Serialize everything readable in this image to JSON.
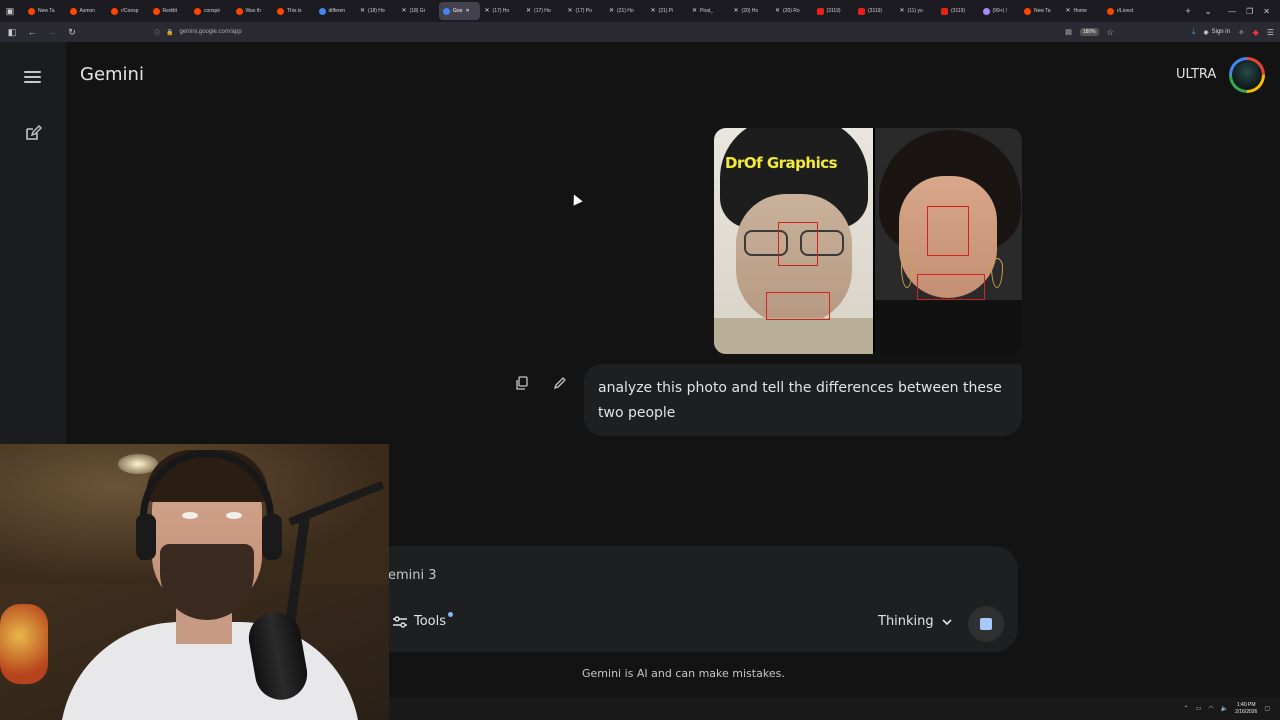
{
  "browser": {
    "tabs": [
      {
        "label": "New Ta",
        "icon": "reddit"
      },
      {
        "label": "Asmon",
        "icon": "reddit"
      },
      {
        "label": "r/Consp",
        "icon": "reddit"
      },
      {
        "label": "Reddit",
        "icon": "reddit"
      },
      {
        "label": "conspir",
        "icon": "reddit"
      },
      {
        "label": "Was th",
        "icon": "reddit"
      },
      {
        "label": "This is",
        "icon": "reddit"
      },
      {
        "label": "differen",
        "icon": "google"
      },
      {
        "label": "(18) Ho",
        "icon": "x"
      },
      {
        "label": "(18) Gr",
        "icon": "x"
      },
      {
        "label": "Goo",
        "icon": "google",
        "active": true
      },
      {
        "label": "(17) Ho",
        "icon": "x"
      },
      {
        "label": "(17) Ho",
        "icon": "x"
      },
      {
        "label": "(17) Po",
        "icon": "x"
      },
      {
        "label": "(21) Ho",
        "icon": "x"
      },
      {
        "label": "(21) Pi",
        "icon": "x"
      },
      {
        "label": "Pirat_",
        "icon": "x"
      },
      {
        "label": "(20) Ho",
        "icon": "x"
      },
      {
        "label": "(20) Ro",
        "icon": "x"
      },
      {
        "label": "(3119)",
        "icon": "yt"
      },
      {
        "label": "(3119)",
        "icon": "yt"
      },
      {
        "label": "(11) yo",
        "icon": "x"
      },
      {
        "label": "(3119)",
        "icon": "yt"
      },
      {
        "label": "(99+) /",
        "icon": "other"
      },
      {
        "label": "New Ta",
        "icon": "reddit"
      },
      {
        "label": "Home",
        "icon": "x"
      },
      {
        "label": "r/Livest",
        "icon": "reddit"
      }
    ],
    "new_tab": "+",
    "tab_list": "⌄",
    "url": "gemini.google.com/app",
    "zoom": "180%",
    "signin": "Sign in"
  },
  "app": {
    "brand": "Gemini",
    "plan": "ULTRA"
  },
  "conversation": {
    "image_watermark": "DrOf Graphics",
    "prompt": "analyze this photo and tell the differences between these two people"
  },
  "composer": {
    "placeholder": "emini 3",
    "tools_label": "Tools",
    "mode_label": "Thinking",
    "disclaimer": "Gemini is AI and can make mistakes."
  },
  "taskbar": {
    "time": "1:40 PM",
    "date": "2/16/2026"
  },
  "colors": {
    "background": "#131314",
    "sidebar": "#1b1c1d",
    "surface": "#1e1f20",
    "accent": "#a8c7fa",
    "annotation_red": "#d2231f",
    "watermark_yellow": "#f4ea3a"
  }
}
